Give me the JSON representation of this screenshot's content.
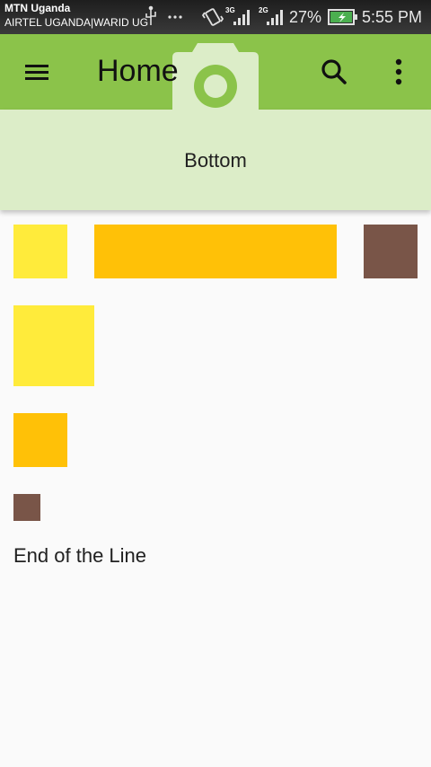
{
  "status_bar": {
    "carrier_primary": "MTN Uganda",
    "carrier_secondary": "AIRTEL UGANDA|WARID UG",
    "network_labels": [
      "3G",
      "2G"
    ],
    "battery_percent": "27%",
    "time": "5:55 PM",
    "icons": [
      "usb-icon",
      "more-notifications-icon",
      "vibrate-icon",
      "signal-3g-icon",
      "signal-2g-icon",
      "battery-charging-icon"
    ]
  },
  "app_bar": {
    "title": "Home",
    "icons": [
      "menu-icon",
      "camera-icon",
      "search-icon",
      "more-vert-icon"
    ],
    "color": "#8bc34a"
  },
  "bottom": {
    "label": "Bottom",
    "color": "#dcedc8"
  },
  "content": {
    "end_text": "End of the Line",
    "colors": {
      "yellow": "#ffeb3b",
      "amber": "#ffc107",
      "brown": "#795548"
    }
  }
}
